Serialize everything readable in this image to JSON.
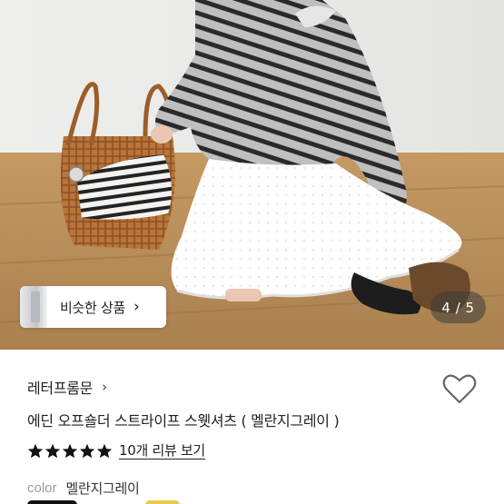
{
  "similar_products": {
    "label": "비슷한 상품",
    "chevron": "›"
  },
  "pager": {
    "text": "4 / 5"
  },
  "product": {
    "brand": "레터프롬문",
    "brand_chevron": "›",
    "title": "에딘 오프숄더 스트라이프 스웻셔츠 ( 멜란지그레이 )",
    "rating": 5,
    "review_link": "10개 리뷰 보기",
    "color_key": "color",
    "color_value": "멜란지그레이"
  },
  "icons": {
    "heart": "heart-icon",
    "star": "star-icon"
  },
  "colors": {
    "star": "#111111",
    "heart_stroke": "#666666",
    "pager_bg": "#3c3c3c"
  }
}
